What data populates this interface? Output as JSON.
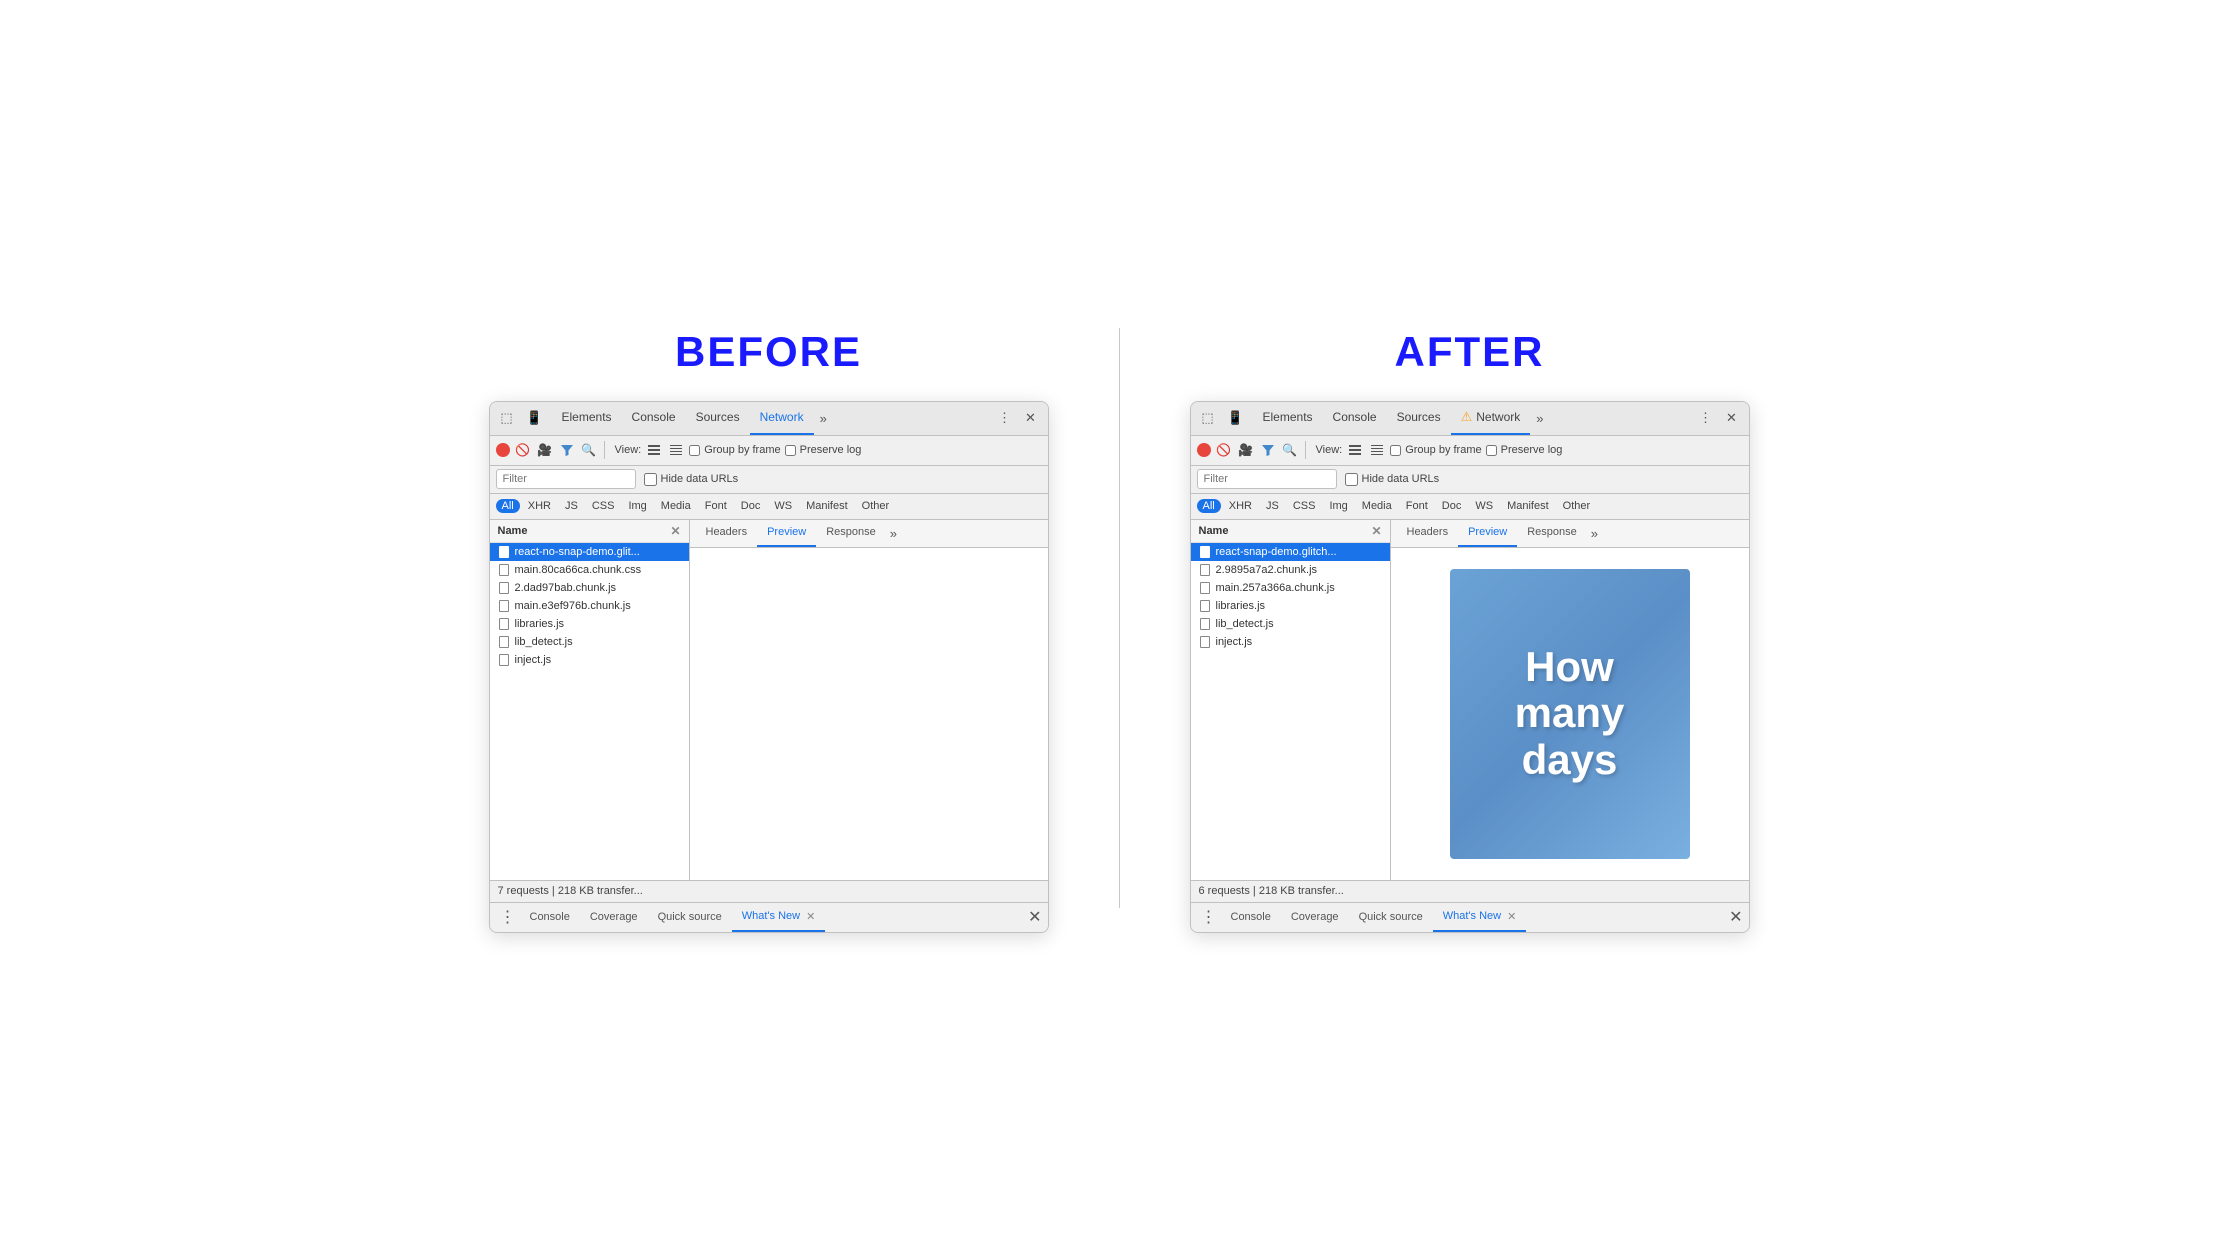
{
  "labels": {
    "before": "BEFORE",
    "after": "AFTER"
  },
  "before": {
    "tabs": [
      "Elements",
      "Console",
      "Sources",
      "Network",
      "»"
    ],
    "active_tab": "Network",
    "toolbar": {
      "view_label": "View:",
      "group_by_frame": "Group by frame",
      "preserve_log": "Preserve log"
    },
    "filter_placeholder": "Filter",
    "hide_data_urls": "Hide data URLs",
    "type_filters": [
      "All",
      "XHR",
      "JS",
      "CSS",
      "Img",
      "Media",
      "Font",
      "Doc",
      "WS",
      "Manifest",
      "Other"
    ],
    "active_type": "All",
    "columns": {
      "name": "Name",
      "headers": "Headers",
      "preview": "Preview",
      "response": "Response"
    },
    "active_preview_tab": "Preview",
    "files": [
      "react-no-snap-demo.glit...",
      "main.80ca66ca.chunk.css",
      "2.dad97bab.chunk.js",
      "main.e3ef976b.chunk.js",
      "libraries.js",
      "lib_detect.js",
      "inject.js"
    ],
    "selected_file": 0,
    "status": "7 requests | 218 KB transfer...",
    "bottom_tabs": [
      "Console",
      "Coverage",
      "Quick source",
      "What's New"
    ],
    "active_bottom_tab": "What's New"
  },
  "after": {
    "tabs": [
      "Elements",
      "Console",
      "Sources",
      "Network",
      "»"
    ],
    "active_tab": "Network",
    "warning": true,
    "toolbar": {
      "view_label": "View:",
      "group_by_frame": "Group by frame",
      "preserve_log": "Preserve log"
    },
    "filter_placeholder": "Filter",
    "hide_data_urls": "Hide data URLs",
    "type_filters": [
      "All",
      "XHR",
      "JS",
      "CSS",
      "Img",
      "Media",
      "Font",
      "Doc",
      "WS",
      "Manifest",
      "Other"
    ],
    "active_type": "All",
    "columns": {
      "name": "Name",
      "headers": "Headers",
      "preview": "Preview",
      "response": "Response"
    },
    "active_preview_tab": "Preview",
    "files": [
      "react-snap-demo.glitch...",
      "2.9895a7a2.chunk.js",
      "main.257a366a.chunk.js",
      "libraries.js",
      "lib_detect.js",
      "inject.js"
    ],
    "selected_file": 0,
    "preview_text": "How many days",
    "status": "6 requests | 218 KB transfer...",
    "bottom_tabs": [
      "Console",
      "Coverage",
      "Quick source",
      "What's New"
    ],
    "active_bottom_tab": "What's New"
  }
}
